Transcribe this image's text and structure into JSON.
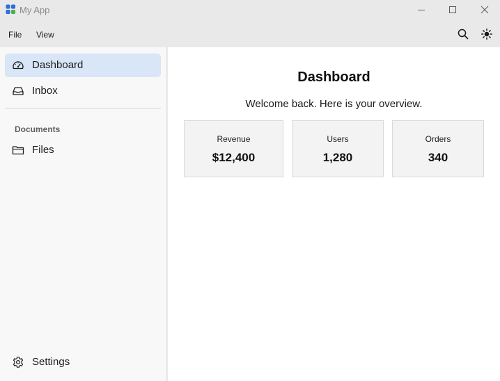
{
  "window": {
    "title": "My App",
    "icons": {
      "logo": "app-logo-icon",
      "minimize": "minimize-icon",
      "maximize": "maximize-icon",
      "close": "close-icon"
    }
  },
  "menubar": {
    "items": [
      {
        "label": "File"
      },
      {
        "label": "View"
      }
    ],
    "tools": {
      "search": "search-icon",
      "theme": "sun-icon"
    }
  },
  "sidebar": {
    "items": [
      {
        "label": "Dashboard",
        "icon": "gauge-icon",
        "active": true
      },
      {
        "label": "Inbox",
        "icon": "inbox-icon",
        "active": false
      }
    ],
    "section": {
      "header": "Documents",
      "items": [
        {
          "label": "Files",
          "icon": "folder-icon"
        }
      ]
    },
    "footer": {
      "label": "Settings",
      "icon": "gear-icon"
    }
  },
  "main": {
    "title": "Dashboard",
    "subtitle": "Welcome back. Here is your overview.",
    "stats": [
      {
        "label": "Revenue",
        "value": "$12,400"
      },
      {
        "label": "Users",
        "value": "1,280"
      },
      {
        "label": "Orders",
        "value": "340"
      }
    ]
  },
  "colors": {
    "chrome": "#e9e9e9",
    "sidebar": "#f8f8f8",
    "active_item": "#d9e6f7",
    "card": "#f3f3f3",
    "logo_blue": "#2f6fd6",
    "logo_green": "#4caf50"
  }
}
